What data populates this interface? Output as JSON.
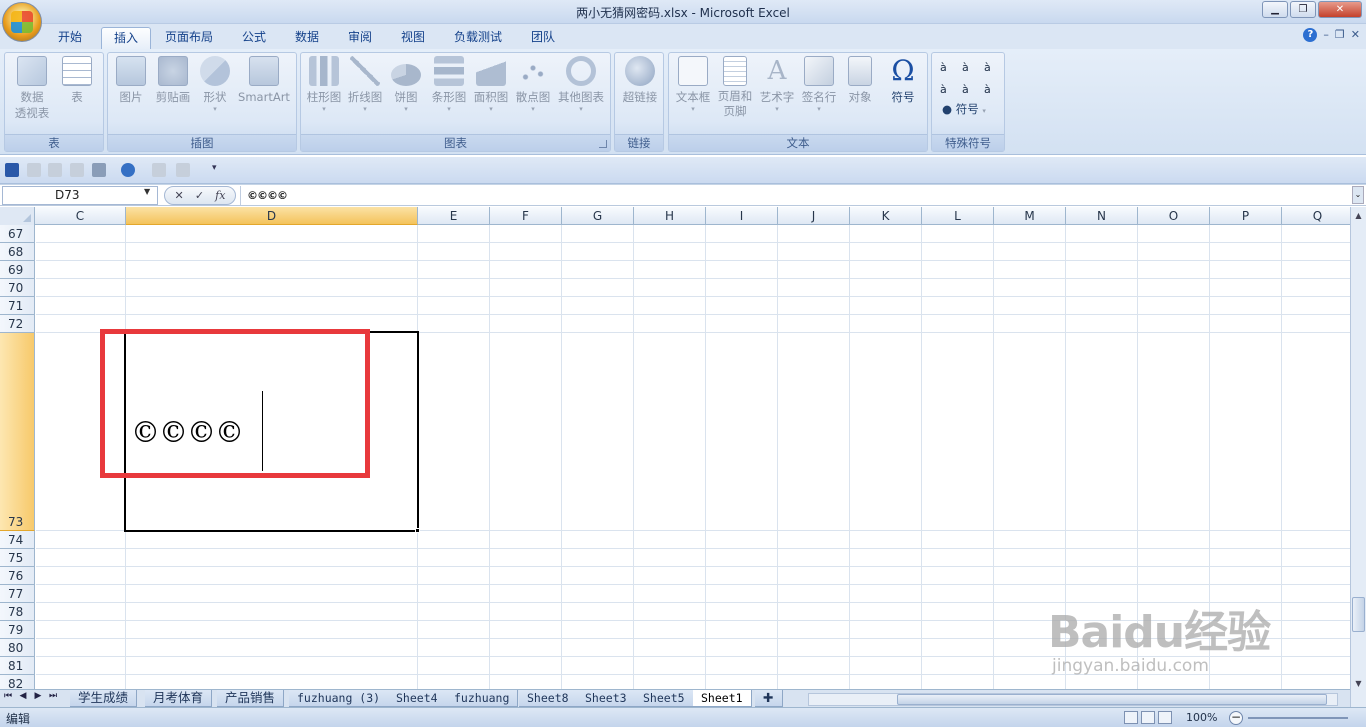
{
  "window": {
    "title": "两小无猜网密码.xlsx - Microsoft Excel"
  },
  "ribbon_tabs": [
    {
      "label": "开始"
    },
    {
      "label": "插入"
    },
    {
      "label": "页面布局"
    },
    {
      "label": "公式"
    },
    {
      "label": "数据"
    },
    {
      "label": "审阅"
    },
    {
      "label": "视图"
    },
    {
      "label": "负载测试"
    },
    {
      "label": "团队"
    }
  ],
  "ribbon": {
    "tables": {
      "label": "表",
      "buttons": [
        "数据\n透视表",
        "表"
      ]
    },
    "illustrations": {
      "label": "插图",
      "buttons": [
        "图片",
        "剪贴画",
        "形状",
        "SmartArt"
      ]
    },
    "charts": {
      "label": "图表",
      "buttons": [
        "柱形图",
        "折线图",
        "饼图",
        "条形图",
        "面积图",
        "散点图",
        "其他图表"
      ]
    },
    "links": {
      "label": "链接",
      "buttons": [
        "超链接"
      ]
    },
    "text": {
      "label": "文本",
      "buttons": [
        "文本框",
        "页眉和\n页脚",
        "艺术字",
        "签名行",
        "对象",
        "符号"
      ]
    },
    "special": {
      "label": "特殊符号",
      "symbols": [
        "à",
        "à",
        "à",
        "à",
        "à",
        "à"
      ],
      "button": "符号"
    }
  },
  "formula_bar": {
    "name_box": "D73",
    "fx": "fx",
    "content": "©©©©"
  },
  "columns": [
    "C",
    "D",
    "E",
    "F",
    "G",
    "H",
    "I",
    "J",
    "K",
    "L",
    "M",
    "N",
    "O",
    "P",
    "Q"
  ],
  "rows": [
    "67",
    "68",
    "69",
    "70",
    "71",
    "72",
    "73",
    "74",
    "75",
    "76",
    "77",
    "78",
    "79",
    "80",
    "81",
    "82"
  ],
  "cell": {
    "ref": "D73",
    "value": "©©©©"
  },
  "sheet_tabs": [
    "学生成绩",
    "月考体育",
    "产品销售",
    "fuzhuang (3)",
    "Sheet4",
    "fuzhuang",
    "Sheet8",
    "Sheet3",
    "Sheet5",
    "Sheet1"
  ],
  "active_sheet": "Sheet1",
  "status": {
    "mode": "编辑",
    "zoom": "100%"
  },
  "watermark": {
    "line1": "Baidu经验",
    "line2": "jingyan.baidu.com"
  },
  "colors": {
    "highlight": "#e8393c",
    "selected_header": "#f4c35c"
  }
}
